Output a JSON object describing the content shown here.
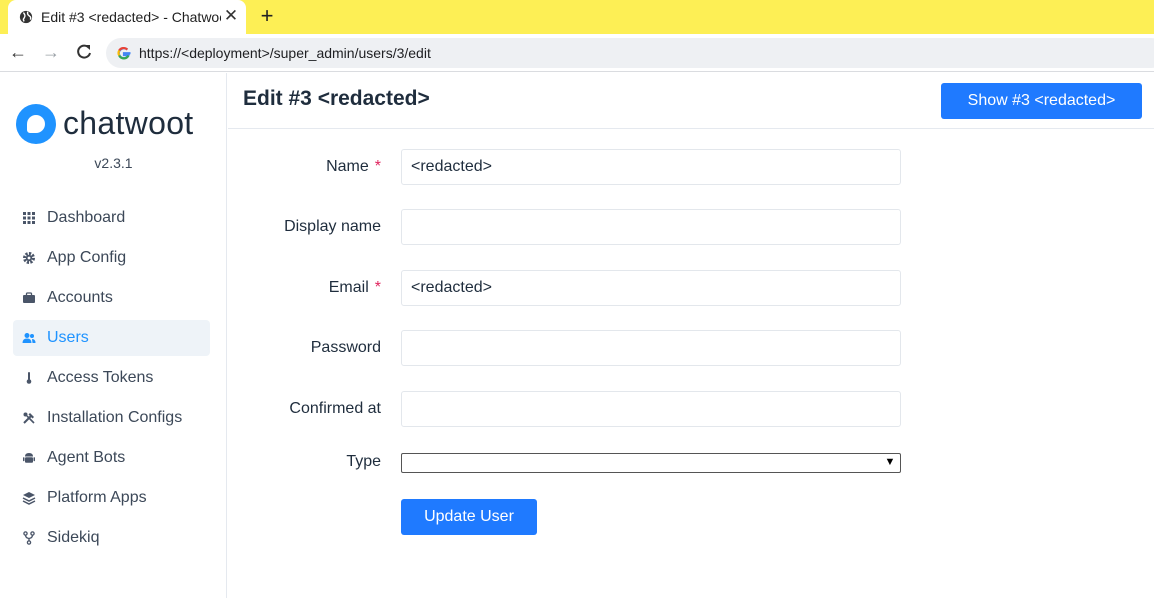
{
  "browser": {
    "tab_title": "Edit #3 <redacted> - Chatwoot",
    "url": "https://<deployment>/super_admin/users/3/edit",
    "colors": {
      "tabbar": "#fdef55"
    }
  },
  "sidebar": {
    "logo_text": "chatwoot",
    "version": "v2.3.1",
    "items": [
      {
        "label": "Dashboard",
        "icon": "grid-icon",
        "active": false
      },
      {
        "label": "App Config",
        "icon": "gear-icon",
        "active": false
      },
      {
        "label": "Accounts",
        "icon": "briefcase-icon",
        "active": false
      },
      {
        "label": "Users",
        "icon": "users-icon",
        "active": true
      },
      {
        "label": "Access Tokens",
        "icon": "thermometer-icon",
        "active": false
      },
      {
        "label": "Installation Configs",
        "icon": "tools-icon",
        "active": false
      },
      {
        "label": "Agent Bots",
        "icon": "android-icon",
        "active": false
      },
      {
        "label": "Platform Apps",
        "icon": "layers-icon",
        "active": false
      },
      {
        "label": "Sidekiq",
        "icon": "fork-icon",
        "active": false
      }
    ]
  },
  "header": {
    "title": "Edit #3 <redacted>",
    "show_button": "Show #3 <redacted>"
  },
  "form": {
    "name": {
      "label": "Name",
      "required": "*",
      "value": "<redacted>"
    },
    "display_name": {
      "label": "Display name",
      "value": ""
    },
    "email": {
      "label": "Email",
      "required": "*",
      "value": "<redacted>"
    },
    "password": {
      "label": "Password",
      "value": ""
    },
    "confirmed_at": {
      "label": "Confirmed at",
      "value": ""
    },
    "type": {
      "label": "Type",
      "value": ""
    },
    "submit": "Update User"
  },
  "colors": {
    "accent": "#1f7aff",
    "brand": "#1f93ff",
    "required": "#e0245e"
  }
}
